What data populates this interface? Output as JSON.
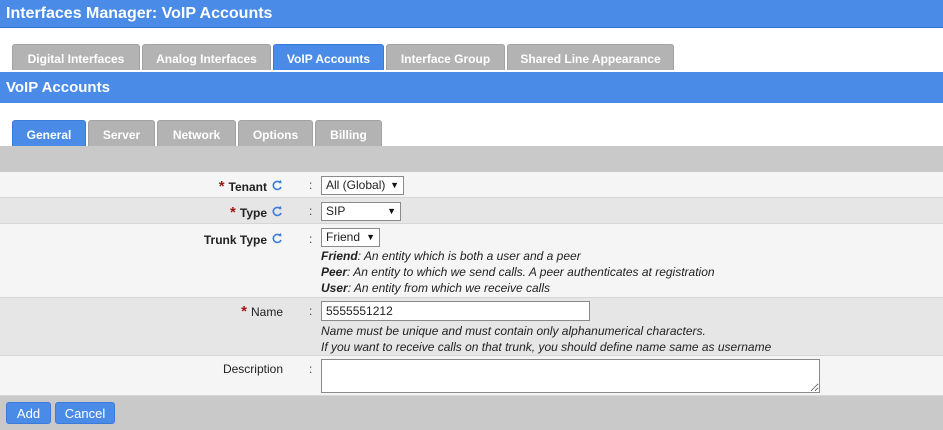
{
  "window": {
    "title": "Interfaces Manager:  VoIP Accounts"
  },
  "top_tabs": [
    {
      "label": "Digital Interfaces",
      "active": false
    },
    {
      "label": "Analog Interfaces",
      "active": false
    },
    {
      "label": "VoIP Accounts",
      "active": true
    },
    {
      "label": "Interface Group",
      "active": false
    },
    {
      "label": "Shared Line Appearance",
      "active": false
    }
  ],
  "section": {
    "title": "VoIP Accounts"
  },
  "sub_tabs": [
    {
      "label": "General",
      "active": true
    },
    {
      "label": "Server",
      "active": false
    },
    {
      "label": "Network",
      "active": false
    },
    {
      "label": "Options",
      "active": false
    },
    {
      "label": "Billing",
      "active": false
    }
  ],
  "form": {
    "tenant": {
      "label": "Tenant",
      "required": true,
      "value": "All (Global)",
      "colon": ":"
    },
    "type": {
      "label": "Type",
      "required": true,
      "value": "SIP",
      "colon": ":"
    },
    "trunk_type": {
      "label": "Trunk Type",
      "value": "Friend",
      "colon": ":",
      "help": [
        {
          "term": "Friend",
          "text": ": An entity which is both a user and a peer"
        },
        {
          "term": "Peer",
          "text": ": An entity to which we send calls. A peer authenticates at registration"
        },
        {
          "term": "User",
          "text": ": An entity from which we receive calls"
        }
      ]
    },
    "name": {
      "label": "Name",
      "required": true,
      "value": "5555551212",
      "colon": ":",
      "help": [
        "Name must be unique and must contain only alphanumerical characters.",
        "If you want to receive calls on that trunk, you should define name same as username"
      ]
    },
    "description": {
      "label": "Description",
      "value": "",
      "colon": ":"
    }
  },
  "buttons": {
    "add": "Add",
    "cancel": "Cancel"
  },
  "required_marker": "*",
  "dropdown_arrow": "▼",
  "colors": {
    "accent": "#4a8be8",
    "required": "#a31515",
    "tab_inactive": "#b3b3b3"
  }
}
